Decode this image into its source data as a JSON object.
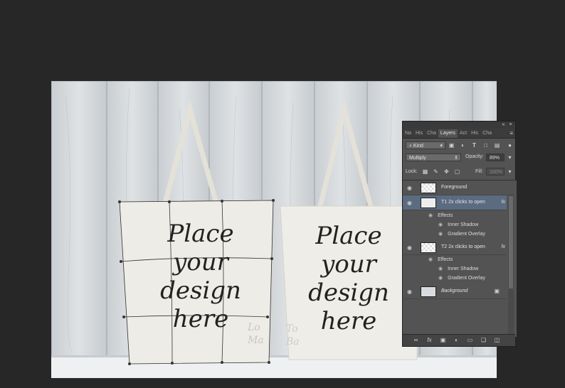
{
  "canvas": {
    "bag_left": {
      "text": [
        "Place",
        "your",
        "design",
        "here"
      ],
      "faint": [
        "Lo",
        "Ma"
      ]
    },
    "bag_right": {
      "text": [
        "Place",
        "your",
        "design",
        "here"
      ],
      "faint": [
        "To",
        "Ba"
      ]
    }
  },
  "panel": {
    "tabs": [
      "Na",
      "His",
      "Cha",
      "Layers",
      "Act",
      "His",
      "Cha"
    ],
    "active_tab": "Layers",
    "kind_label": "Kind",
    "blend_mode": "Multiply",
    "opacity_label": "Opacity:",
    "opacity_value": "89%",
    "lock_label": "Lock:",
    "fill_label": "Fill:",
    "fill_value": "100%",
    "layers": [
      {
        "name": "Foreground"
      },
      {
        "name": "T1 2x clicks to open",
        "fx": "fx",
        "effects_label": "Effects",
        "effects": [
          "Inner Shadow",
          "Gradient Overlay"
        ]
      },
      {
        "name": "T2 2x clicks to open",
        "fx": "fx",
        "effects_label": "Effects",
        "effects": [
          "Inner Shadow",
          "Gradient Overlay"
        ]
      },
      {
        "name": "Background"
      }
    ],
    "footer_icons": [
      "link-icon",
      "fx-icon",
      "mask-icon",
      "adjustment-icon",
      "folder-icon",
      "new-layer-icon",
      "trash-icon"
    ],
    "footer_fx": "fx"
  }
}
